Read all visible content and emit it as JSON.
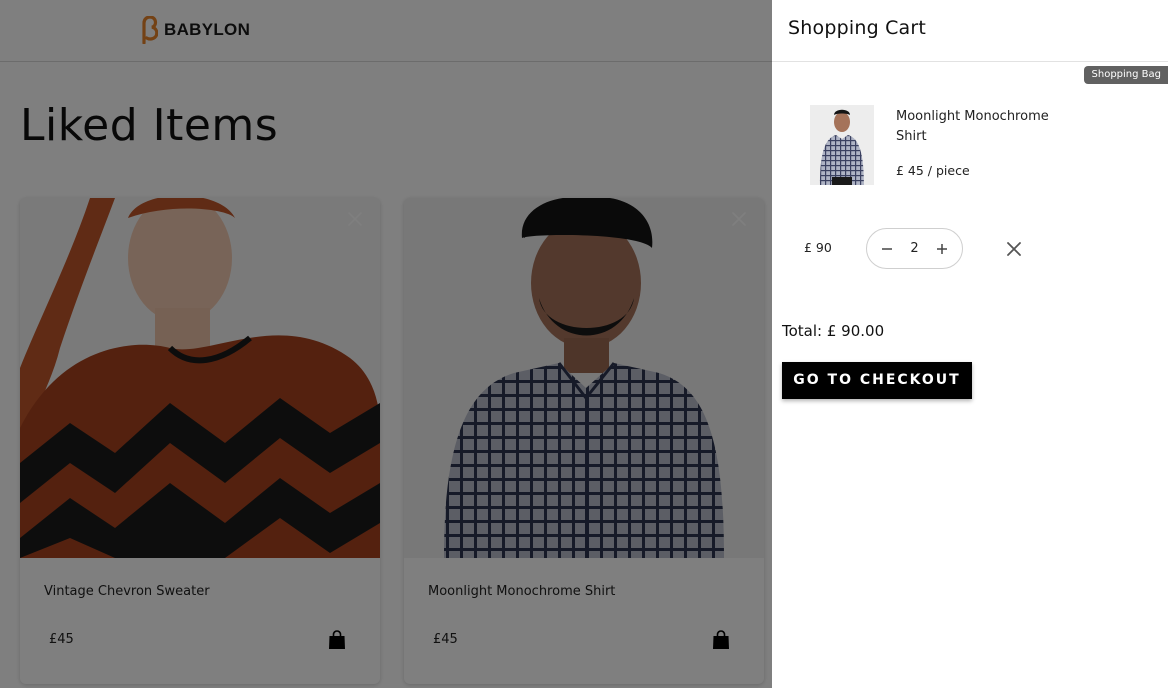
{
  "header": {
    "brand": "BABYLON",
    "brand_color": "#e8852b"
  },
  "page": {
    "title": "Liked Items"
  },
  "liked_items": [
    {
      "name": "Vintage Chevron Sweater",
      "price": "£45",
      "close_icon": "close-icon",
      "bag_icon": "shopping-bag-icon"
    },
    {
      "name": "Moonlight Monochrome Shirt",
      "price": "£45",
      "close_icon": "close-icon",
      "bag_icon": "shopping-bag-icon"
    }
  ],
  "cart": {
    "title": "Shopping Cart",
    "tooltip": "Shopping Bag",
    "items": [
      {
        "name": "Moonlight Monochrome Shirt",
        "unit_price": "£ 45 / piece",
        "subtotal": "£ 90",
        "quantity": "2"
      }
    ],
    "total": "Total: £ 90.00",
    "checkout_label": "GO TO CHECKOUT"
  }
}
